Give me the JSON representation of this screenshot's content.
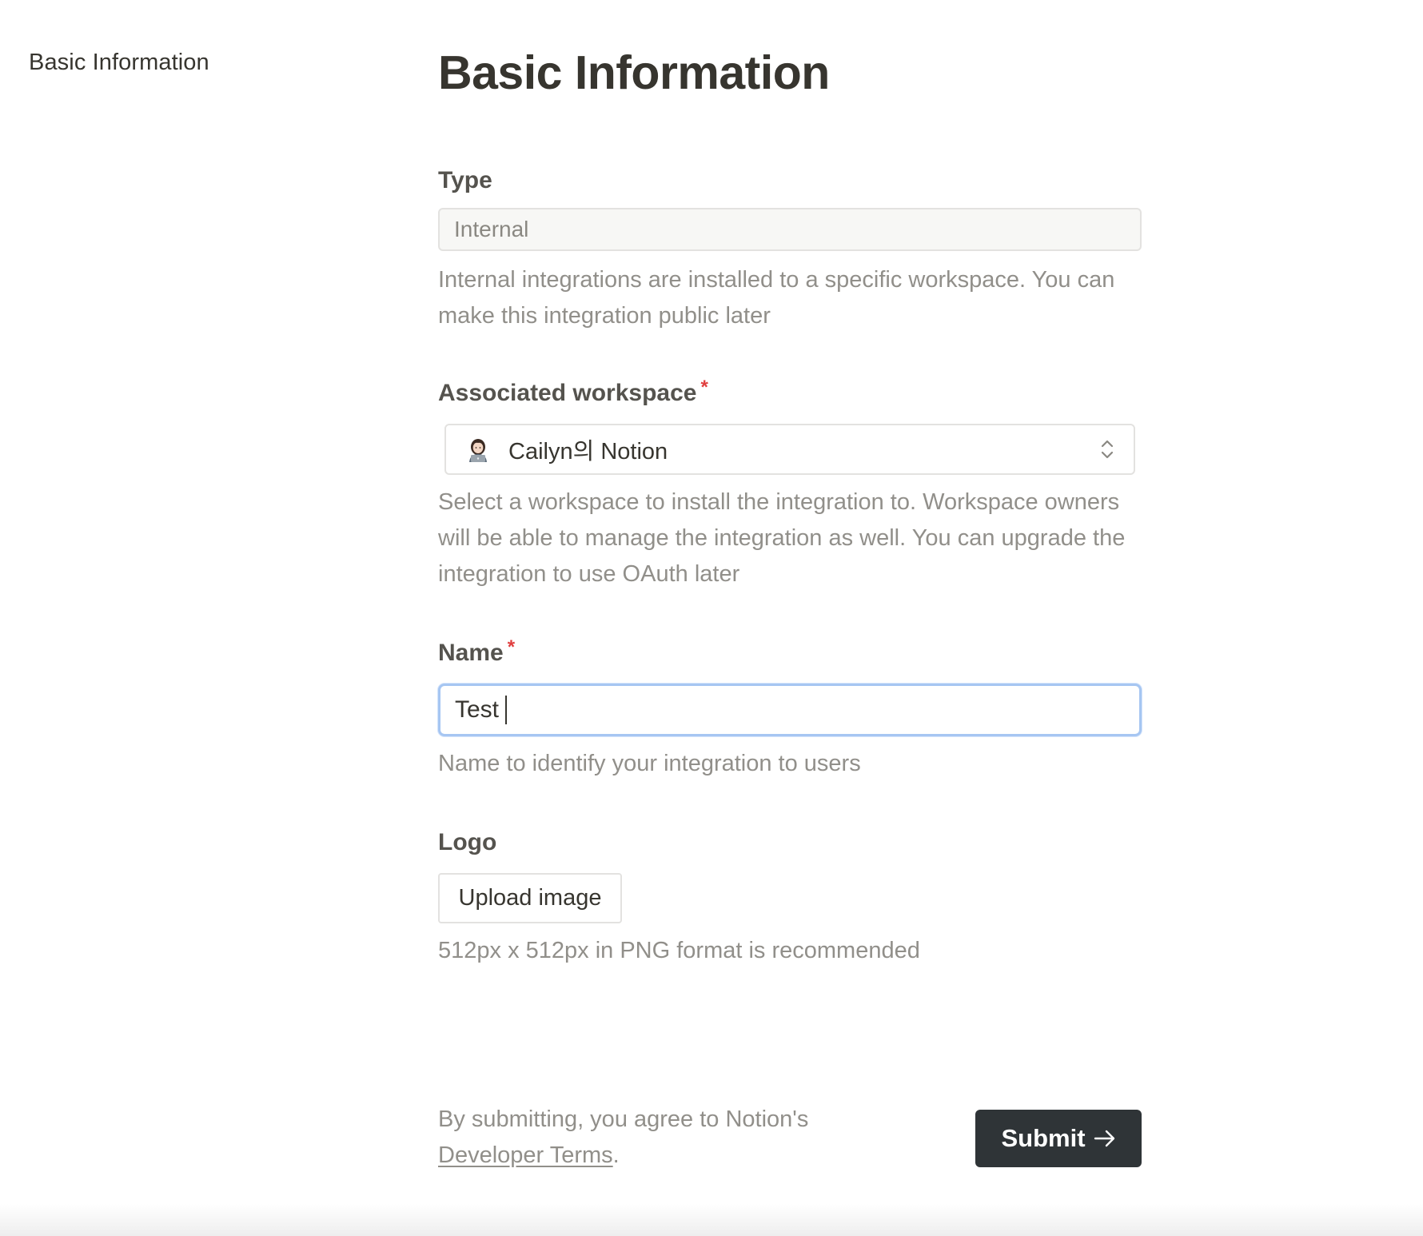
{
  "sidebar": {
    "items": [
      {
        "label": "Basic Information"
      }
    ]
  },
  "main": {
    "title": "Basic Information",
    "type_field": {
      "label": "Type",
      "value": "Internal",
      "helper": "Internal integrations are installed to a specific workspace. You can make this integration public later"
    },
    "workspace_field": {
      "label": "Associated workspace",
      "required_mark": "*",
      "selected": "Cailyn의 Notion",
      "avatar_icon": "woman-technologist-emoji-icon",
      "chevron_icon": "chevron-up-down-icon",
      "helper": "Select a workspace to install the integration to. Workspace owners will be able to manage the integration as well. You can upgrade the integration to use OAuth later"
    },
    "name_field": {
      "label": "Name",
      "required_mark": "*",
      "value": "Test",
      "helper": "Name to identify your integration to users"
    },
    "logo_field": {
      "label": "Logo",
      "upload_label": "Upload image",
      "helper": "512px x 512px in PNG format is recommended"
    }
  },
  "footer": {
    "terms_prefix": "By submitting, you agree to Notion's",
    "terms_link": "Developer Terms",
    "terms_suffix": ".",
    "submit_label": "Submit",
    "submit_icon": "arrow-right-icon"
  },
  "colors": {
    "text": "#37352f",
    "muted": "#918f8a",
    "required": "#e03e3e",
    "focus_ring": "#a6c6f2",
    "submit_bg": "#2f3437"
  }
}
